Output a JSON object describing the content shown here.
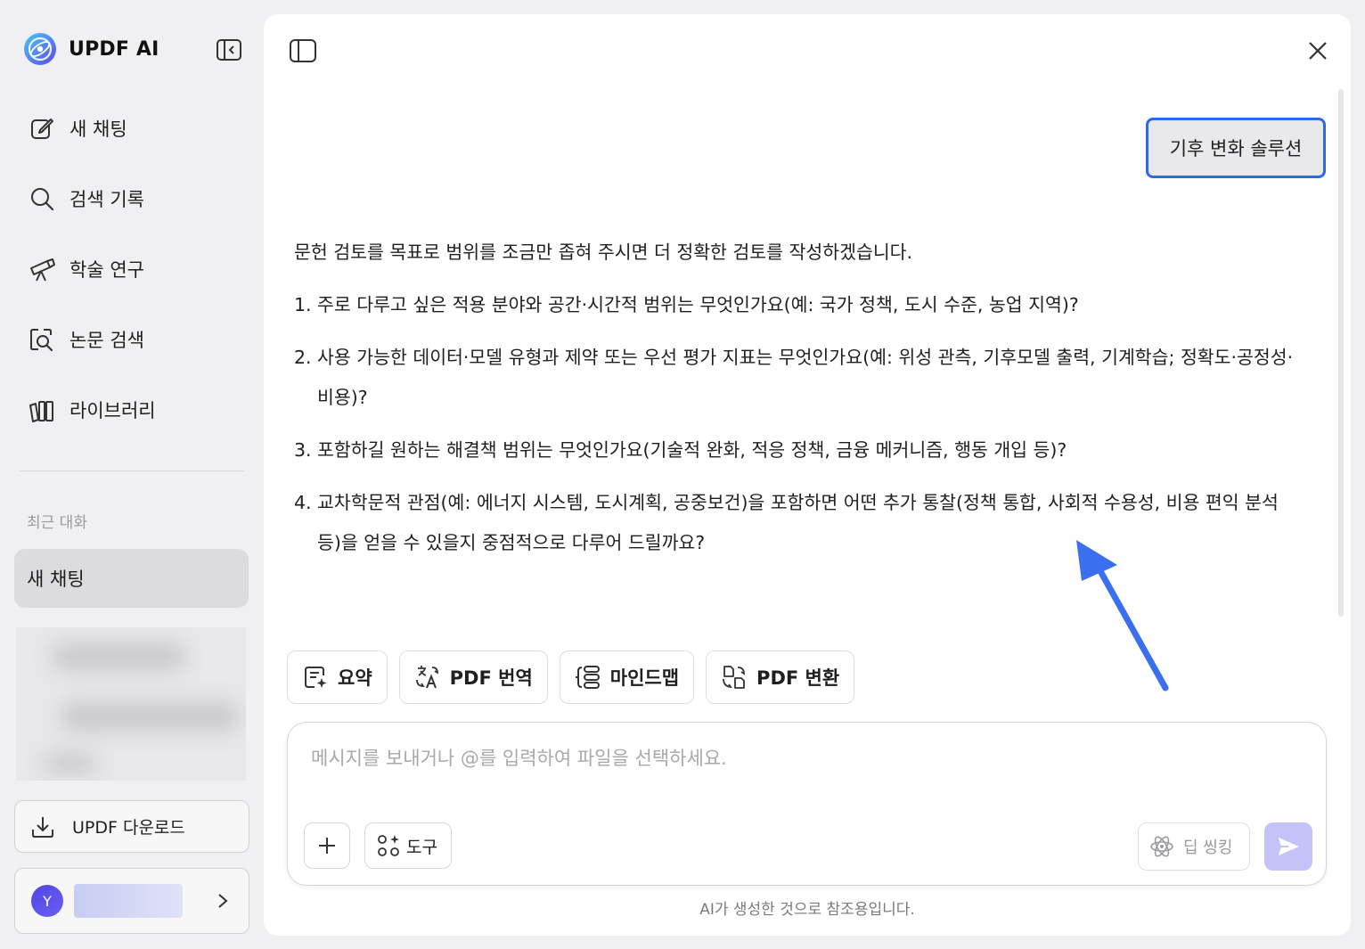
{
  "app": {
    "title": "UPDF AI"
  },
  "sidebar": {
    "nav": [
      {
        "label": "새 채팅",
        "icon": "edit-icon"
      },
      {
        "label": "검색 기록",
        "icon": "search-icon"
      },
      {
        "label": "학술 연구",
        "icon": "telescope-icon"
      },
      {
        "label": "논문 검색",
        "icon": "paper-search-icon"
      },
      {
        "label": "라이브러리",
        "icon": "library-icon"
      }
    ],
    "recent_title": "최근 대화",
    "recent_items": [
      {
        "label": "새 채팅"
      }
    ],
    "download_label": "UPDF 다운로드",
    "user": {
      "avatar_letter": "Y"
    }
  },
  "chat": {
    "user_message": "기후 변화 솔루션",
    "answer_intro": "문헌 검토를 목표로 범위를 조금만 좁혀 주시면 더 정확한 검토를 작성하겠습니다.",
    "answer_items": [
      {
        "num": "1.",
        "text": "주로 다루고 싶은 적용 분야와 공간·시간적 범위는 무엇인가요(예: 국가 정책, 도시 수준, 농업 지역)?"
      },
      {
        "num": "2.",
        "text": "사용 가능한 데이터·모델 유형과 제약 또는 우선 평가 지표는 무엇인가요(예: 위성 관측, 기후모델 출력, 기계학습; 정확도·공정성·비용)?"
      },
      {
        "num": "3.",
        "text": "포함하길 원하는 해결책 범위는 무엇인가요(기술적 완화, 적응 정책, 금융 메커니즘, 행동 개입 등)?"
      },
      {
        "num": "4.",
        "text": "교차학문적 관점(예: 에너지 시스템, 도시계획, 공중보건)을 포함하면 어떤 추가 통찰(정책 통합, 사회적 수용성, 비용 편익 분석 등)을 얻을 수 있을지 중점적으로 다루어 드릴까요?"
      }
    ]
  },
  "tools": [
    {
      "label": "요약",
      "icon": "summary-icon"
    },
    {
      "label": "PDF 번역",
      "icon": "translate-icon"
    },
    {
      "label": "마인드맵",
      "icon": "mindmap-icon"
    },
    {
      "label": "PDF 변환",
      "icon": "convert-icon"
    }
  ],
  "composer": {
    "placeholder": "메시지를 보내거나 @를 입력하여 파일을 선택하세요.",
    "tools_label": "도구",
    "deep_thinking_label": "딥 씽킹"
  },
  "disclaimer": "AI가 생성한 것으로 참조용입니다.",
  "colors": {
    "accent": "#2f6ae6",
    "send": "#c5c2f7",
    "arrow": "#3a6ff0"
  }
}
